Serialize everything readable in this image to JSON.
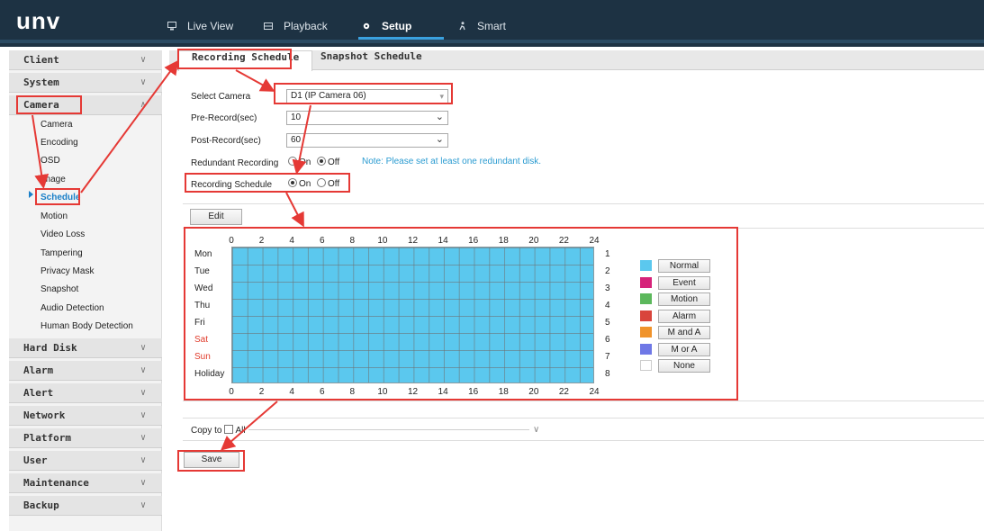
{
  "app": {
    "logo": "unv"
  },
  "nav": {
    "items": [
      {
        "label": "Live View",
        "icon": "monitor-icon"
      },
      {
        "label": "Playback",
        "icon": "film-icon"
      },
      {
        "label": "Setup",
        "icon": "gear-icon"
      },
      {
        "label": "Smart",
        "icon": "person-run-icon"
      }
    ],
    "active": "Setup"
  },
  "sidebar": {
    "sections": [
      "Client",
      "System",
      "Camera",
      "Hard Disk",
      "Alarm",
      "Alert",
      "Network",
      "Platform",
      "User",
      "Maintenance",
      "Backup"
    ],
    "camera_subitems": [
      "Camera",
      "Encoding",
      "OSD",
      "Image",
      "Schedule",
      "Motion",
      "Video Loss",
      "Tampering",
      "Privacy Mask",
      "Snapshot",
      "Audio Detection",
      "Human Body Detection"
    ],
    "selected": "Schedule"
  },
  "tabs": [
    "Recording Schedule",
    "Snapshot Schedule"
  ],
  "form": {
    "select_camera_label": "Select Camera",
    "select_camera_value": "D1 (IP Camera 06)",
    "pre_record_label": "Pre-Record(sec)",
    "pre_record_value": "10",
    "post_record_label": "Post-Record(sec)",
    "post_record_value": "60",
    "redundant_label": "Redundant Recording",
    "redundant_on": "On",
    "redundant_off": "Off",
    "redundant_selected": "Off",
    "redundant_note": "Note: Please set at least one redundant disk.",
    "schedule_label": "Recording Schedule",
    "schedule_on": "On",
    "schedule_off": "Off",
    "schedule_selected": "On"
  },
  "edit_button": "Edit",
  "schedule": {
    "hours": [
      "0",
      "2",
      "4",
      "6",
      "8",
      "10",
      "12",
      "14",
      "16",
      "18",
      "20",
      "22",
      "24"
    ],
    "days": [
      "Mon",
      "Tue",
      "Wed",
      "Thu",
      "Fri",
      "Sat",
      "Sun",
      "Holiday"
    ],
    "row_numbers": [
      "1",
      "2",
      "3",
      "4",
      "5",
      "6",
      "7",
      "8"
    ],
    "fill_color": "#5bc8ee",
    "legend": [
      {
        "label": "Normal",
        "color": "#5bc8ee"
      },
      {
        "label": "Event",
        "color": "#d6237a"
      },
      {
        "label": "Motion",
        "color": "#5cb85c"
      },
      {
        "label": "Alarm",
        "color": "#d9453c"
      },
      {
        "label": "M and A",
        "color": "#f0932b"
      },
      {
        "label": "M or A",
        "color": "#6f78e6"
      },
      {
        "label": "None",
        "color": "#ffffff"
      }
    ]
  },
  "copy": {
    "label": "Copy to",
    "all_label": "All"
  },
  "save_button": "Save",
  "annotation_color": "#e53935"
}
